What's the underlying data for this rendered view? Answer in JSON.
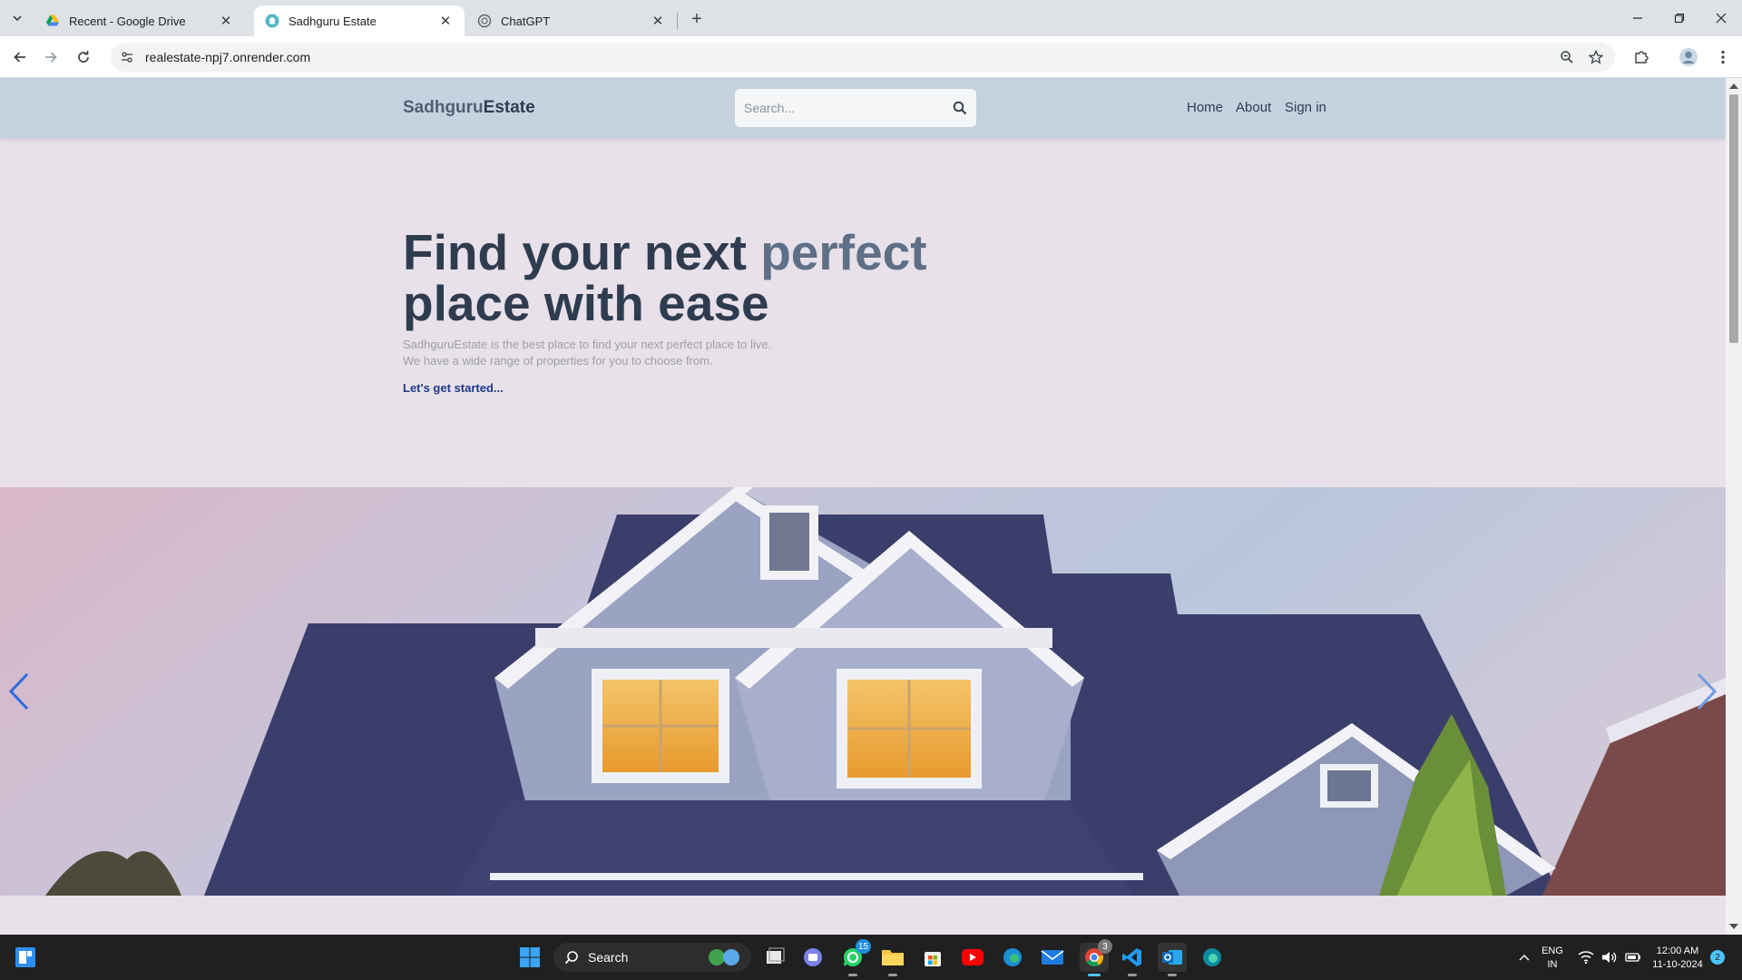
{
  "browser": {
    "tabs": [
      {
        "title": "Recent - Google Drive",
        "active": false,
        "favicon": "google-drive-icon"
      },
      {
        "title": "Sadhguru Estate",
        "active": true,
        "favicon": "site-icon"
      },
      {
        "title": "ChatGPT",
        "active": false,
        "favicon": "chatgpt-icon"
      }
    ],
    "url": "realestate-npj7.onrender.com"
  },
  "site": {
    "logo_part1": "Sadhguru",
    "logo_part2": "Estate",
    "search_placeholder": "Search...",
    "nav": {
      "home": "Home",
      "about": "About",
      "signin": "Sign in"
    },
    "hero": {
      "title_part1": "Find your next ",
      "title_accent": "perfect",
      "title_part2": "place with ease",
      "subtitle_line1": "SadhguruEstate is the best place to find your next perfect place to live.",
      "subtitle_line2": "We have a wide range of properties for you to choose from.",
      "cta": "Let's get started..."
    },
    "slider": {
      "image": "house-photo",
      "prev_icon": "chevron-left-icon",
      "next_icon": "chevron-right-icon"
    }
  },
  "taskbar": {
    "search_label": "Search",
    "whatsapp_badge": "15",
    "chrome_badge": "3",
    "language_line1": "ENG",
    "language_line2": "IN",
    "time": "12:00 AM",
    "date": "11-10-2024",
    "notification_count": "2"
  },
  "colors": {
    "page_bg": "#e8e1ea",
    "header_bg": "#c7d2e0",
    "title": "#2f3c50",
    "title_accent": "#5f6f86",
    "cta": "#1e3a8a"
  }
}
